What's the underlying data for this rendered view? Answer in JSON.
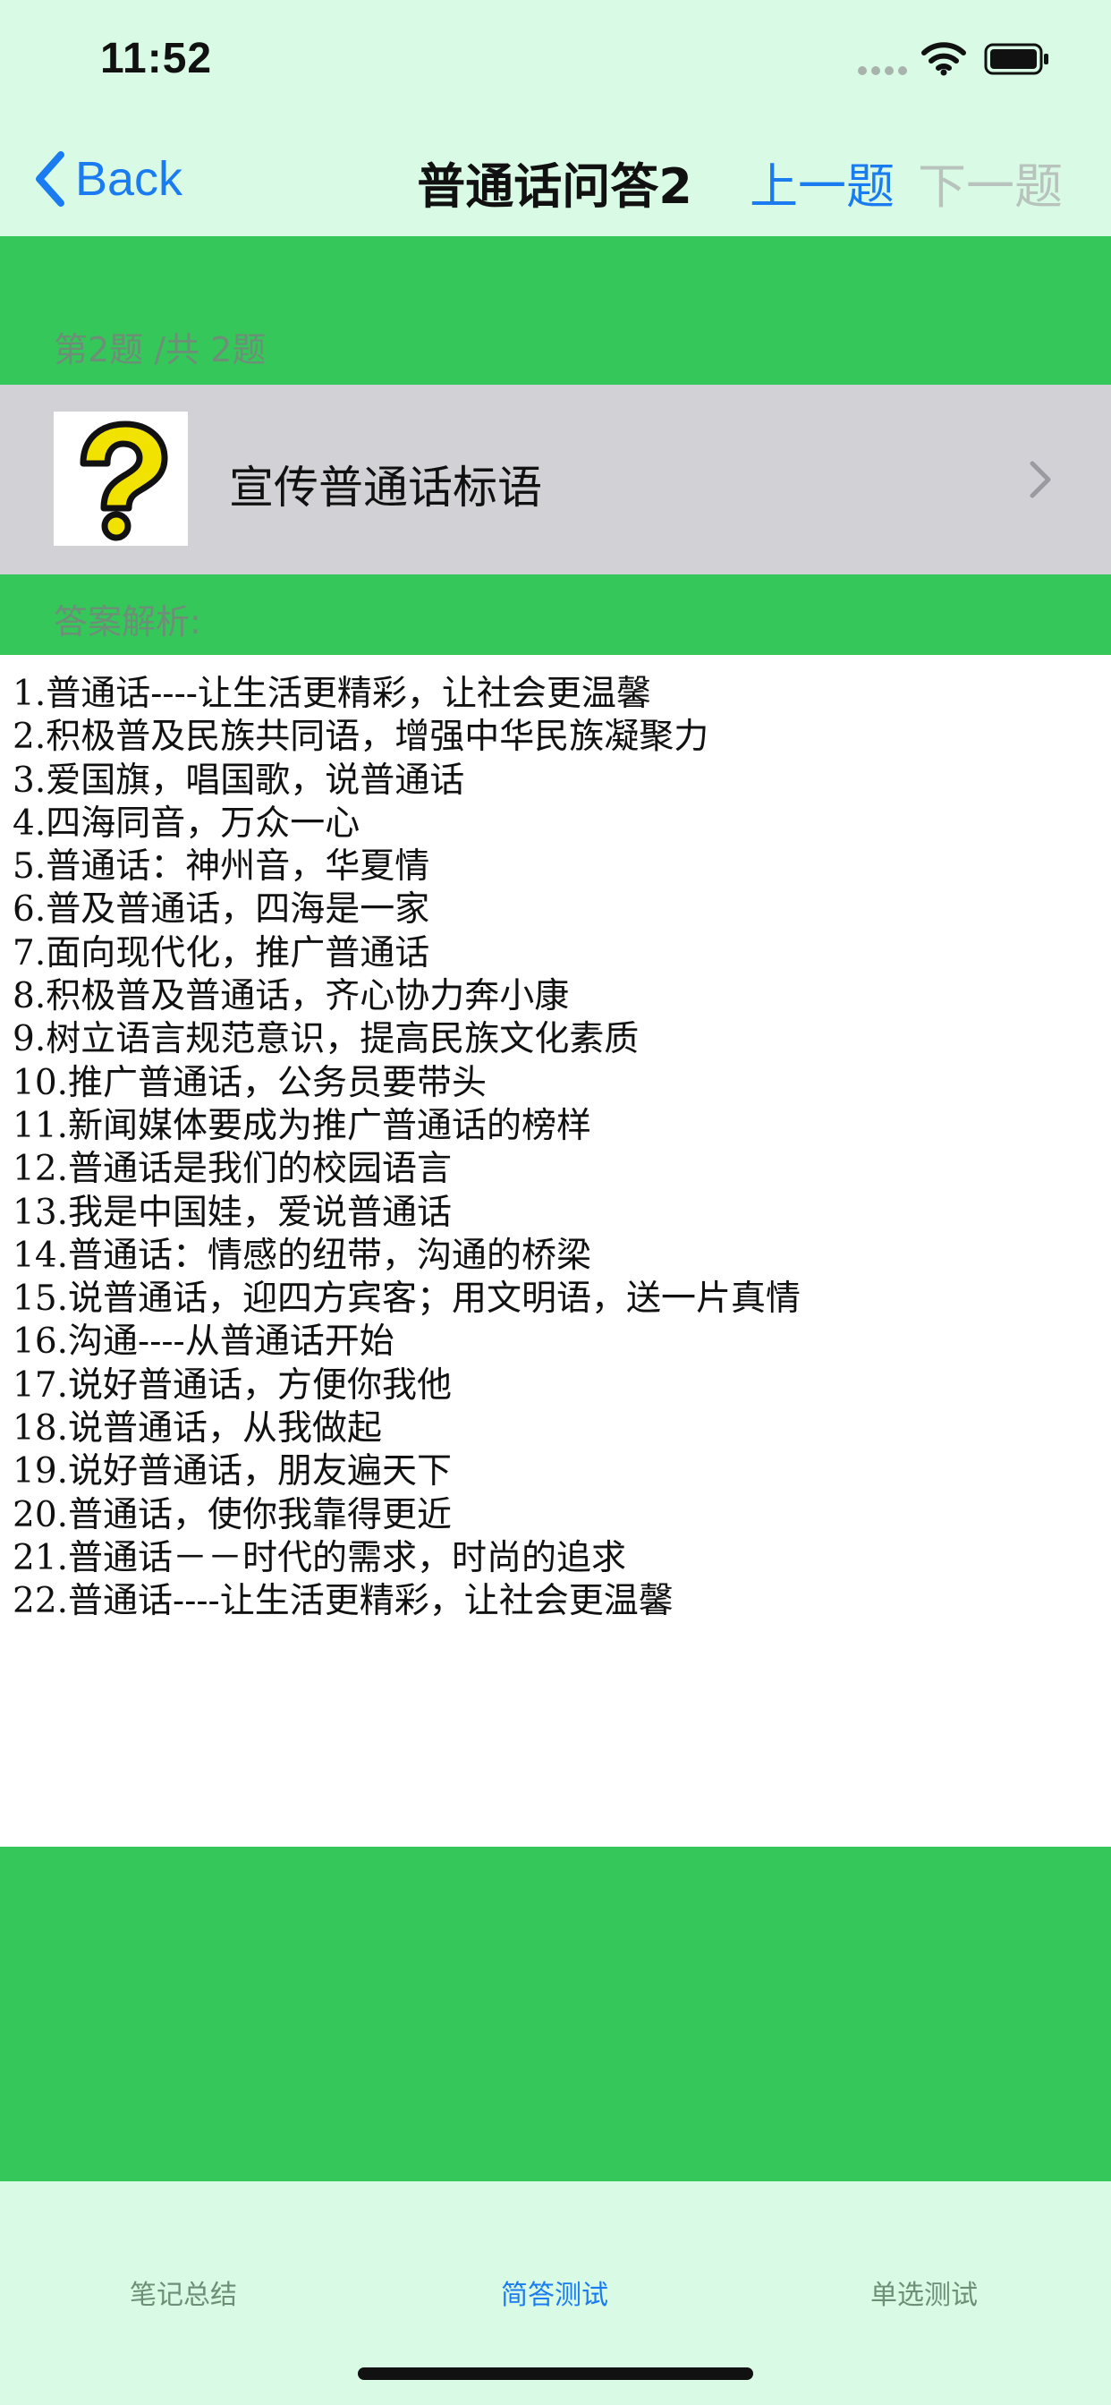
{
  "status_bar": {
    "time": "11:52"
  },
  "nav": {
    "back_label": "Back",
    "title": "普通话问答2",
    "prev_label": "上一题",
    "next_label": "下一题"
  },
  "progress": {
    "label": "第2题 /共 2题"
  },
  "question": {
    "icon": "question-mark-icon",
    "text": "宣传普通话标语"
  },
  "answer": {
    "header": "答案解析:",
    "lines": [
      "1.普通话----让生活更精彩，让社会更温馨",
      "2.积极普及民族共同语，增强中华民族凝聚力",
      "3.爱国旗，唱国歌，说普通话",
      "4.四海同音，万众一心",
      "5.普通话：神州音，华夏情",
      "6.普及普通话，四海是一家",
      "7.面向现代化，推广普通话",
      "8.积极普及普通话，齐心协力奔小康",
      "9.树立语言规范意识，提高民族文化素质",
      "10.推广普通话，公务员要带头",
      "11.新闻媒体要成为推广普通话的榜样",
      "12.普通话是我们的校园语言",
      "13.我是中国娃，爱说普通话",
      "14.普通话：情感的纽带，沟通的桥梁",
      "15.说普通话，迎四方宾客；用文明语，送一片真情",
      "16.沟通----从普通话开始",
      "17.说好普通话，方便你我他",
      "18.说普通话，从我做起",
      "19.说好普通话，朋友遍天下",
      "20.普通话，使你我靠得更近",
      "21.普通话－－时代的需求，时尚的追求",
      "22.普通话----让生活更精彩，让社会更温馨"
    ]
  },
  "tabs": {
    "notes": "笔记总结",
    "qa": "简答测试",
    "single": "单选测试",
    "active": "qa"
  },
  "colors": {
    "background": "#d9fbe6",
    "green": "#35c75a",
    "accent": "#1a7cf0",
    "disabled": "#b8c3bd",
    "row": "#d1d1d6"
  }
}
